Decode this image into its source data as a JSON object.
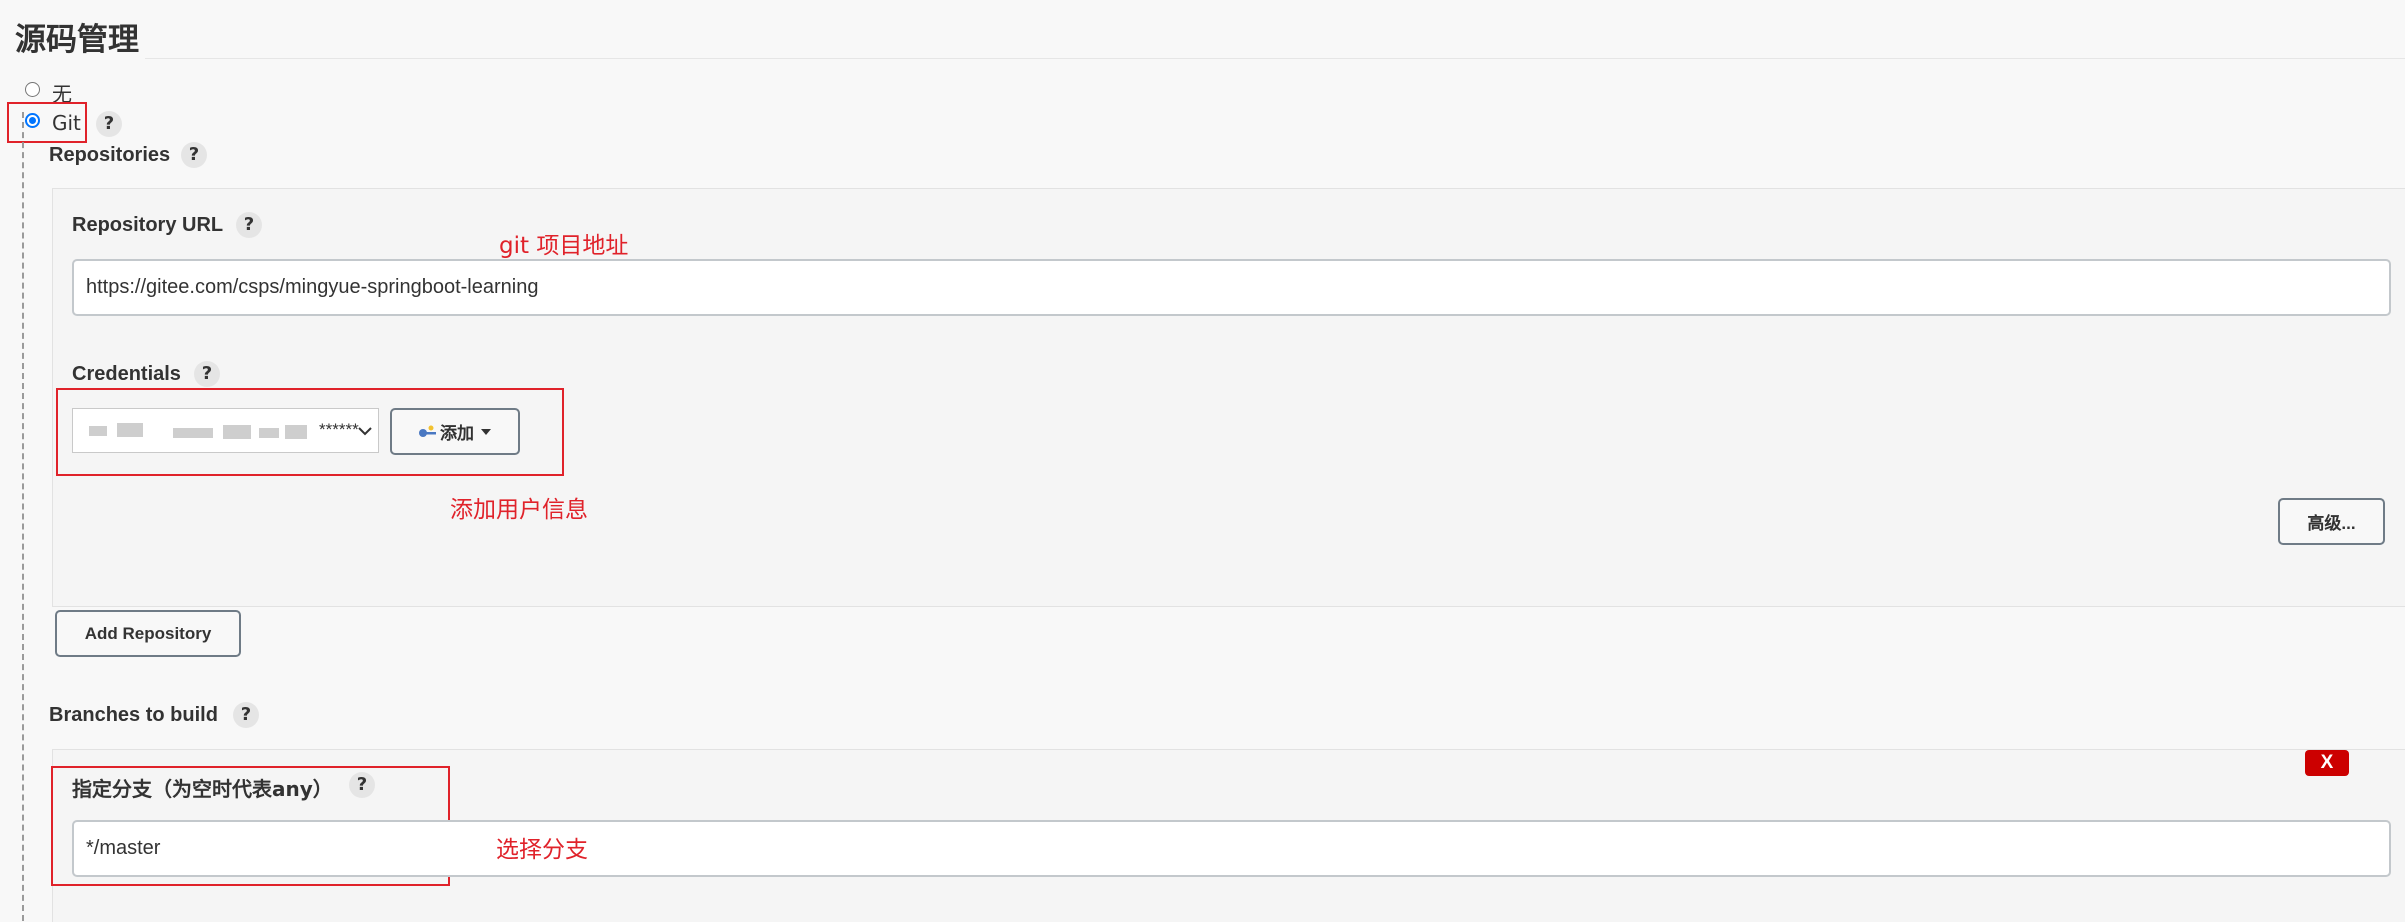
{
  "section_title": "源码管理",
  "scm_options": {
    "none_label": "无",
    "git_label": "Git"
  },
  "repositories": {
    "label": "Repositories",
    "url_label": "Repository URL",
    "url_value": "https://gitee.com/csps/mingyue-springboot-learning",
    "credentials_label": "Credentials",
    "credentials_value": "******",
    "add_button_label": "添加",
    "advanced_button_label": "高级...",
    "add_repository_label": "Add Repository"
  },
  "branches": {
    "label": "Branches to build",
    "branch_specifier_label": "指定分支（为空时代表any）",
    "branch_value": "*/master",
    "delete_label": "X"
  },
  "annotations": {
    "git_url_note": "git 项目地址",
    "credentials_note": "添加用户信息",
    "branch_note": "选择分支"
  },
  "help_glyph": "?",
  "colors": {
    "annotation_red": "#e0222a",
    "radio_blue": "#0075ff",
    "delete_red": "#cc0000"
  }
}
